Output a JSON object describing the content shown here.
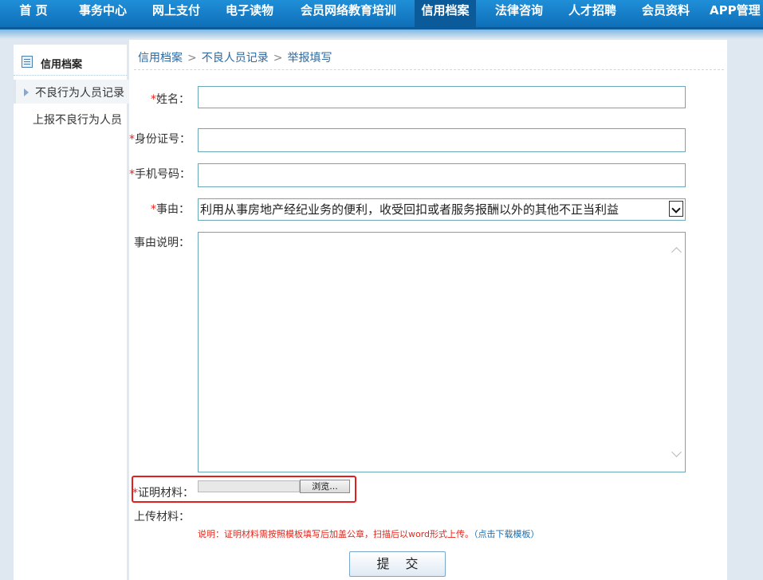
{
  "nav": {
    "items": [
      {
        "label": "首 页",
        "active": false
      },
      {
        "label": "事务中心",
        "active": false
      },
      {
        "label": "网上支付",
        "active": false
      },
      {
        "label": "电子读物",
        "active": false
      },
      {
        "label": "会员网络教育培训",
        "active": false
      },
      {
        "label": "信用档案",
        "active": true
      },
      {
        "label": "法律咨询",
        "active": false
      },
      {
        "label": "人才招聘",
        "active": false
      },
      {
        "label": "会员资料",
        "active": false
      },
      {
        "label": "APP管理",
        "active": false
      }
    ]
  },
  "sidebar": {
    "title": "信用档案",
    "items": [
      {
        "label": "不良行为人员记录",
        "selected": true
      },
      {
        "label": "上报不良行为人员",
        "selected": false
      }
    ]
  },
  "breadcrumb": {
    "items": [
      "信用档案",
      "不良人员记录",
      "举报填写"
    ],
    "separator": ">"
  },
  "form": {
    "required_mark": "*",
    "name_label": "姓名：",
    "name_value": "",
    "id_label": "身份证号：",
    "id_value": "",
    "phone_label": "手机号码：",
    "phone_value": "",
    "reason_label": "事由：",
    "reason_selected": "利用从事房地产经纪业务的便利，收受回扣或者服务报酬以外的其他不正当利益",
    "description_label": "事由说明：",
    "description_value": "",
    "evidence_label": "证明材料：",
    "browse_label": "浏览...",
    "upload_label": "上传材料：",
    "note_text": "说明：证明材料需按照模板填写后加盖公章，扫描后以word形式上传。",
    "note_link": "（点击下载模板）",
    "submit_label": "提交"
  },
  "colors": {
    "nav_bg": "#1585cf",
    "accent": "#2c6aa0",
    "required": "#e2261b",
    "highlight_border": "#e31e1e"
  }
}
